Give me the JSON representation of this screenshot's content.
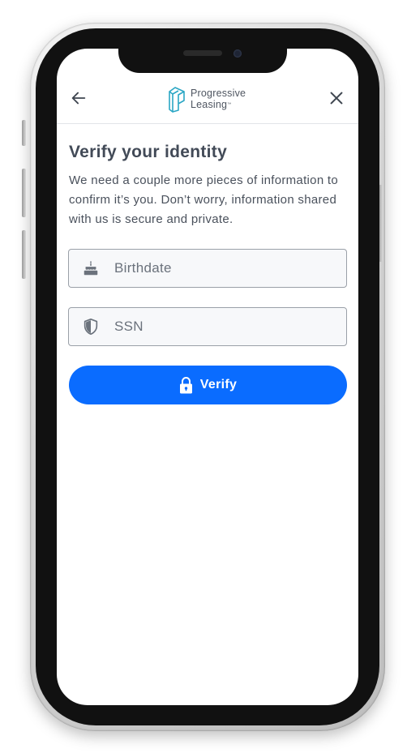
{
  "header": {
    "back_icon": "arrow-left-icon",
    "close_icon": "close-icon",
    "logo_line1": "Progressive",
    "logo_line2": "Leasing",
    "logo_tm": "™"
  },
  "main": {
    "title": "Verify your identity",
    "description": "We need a couple more pieces of information to confirm it’s you. Don’t worry, information shared with us is secure and private.",
    "fields": {
      "birthdate": {
        "placeholder": "Birthdate",
        "value": "",
        "icon": "birthday-cake-icon"
      },
      "ssn": {
        "placeholder": "SSN",
        "value": "",
        "icon": "shield-icon"
      }
    },
    "verify_button": {
      "label": "Verify",
      "icon": "lock-icon"
    }
  },
  "colors": {
    "primary": "#0a6cff",
    "logo_teal": "#2aa6c4",
    "text": "#424a57",
    "field_bg": "#f7f8fa",
    "field_border": "#9aa0a8"
  }
}
